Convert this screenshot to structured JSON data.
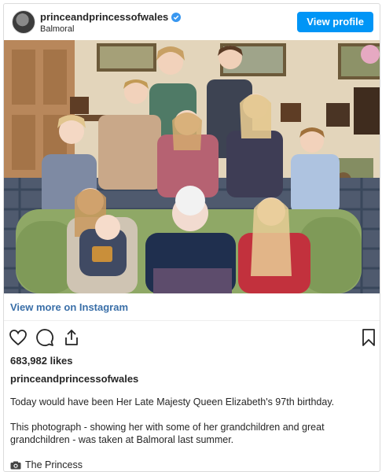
{
  "header": {
    "username": "princeandprincessofwales",
    "location": "Balmoral",
    "view_profile_label": "View profile"
  },
  "photo": {
    "icon": "family-photo"
  },
  "view_more_label": "View more on Instagram",
  "actions": {
    "icons": [
      "heart-icon",
      "comment-icon",
      "share-icon",
      "bookmark-icon"
    ]
  },
  "likes": "683,982 likes",
  "caption": {
    "username": "princeandprincessofwales",
    "line1": "Today would have been Her Late Majesty Queen Elizabeth's 97th birthday.",
    "line2": "This photograph - showing her with some of her grandchildren and great grandchildren - was taken at Balmoral last summer.",
    "line3": "The Princess"
  },
  "colors": {
    "accent": "#0095f6",
    "link": "#3a6fa8",
    "sofa": "#8fa866"
  }
}
